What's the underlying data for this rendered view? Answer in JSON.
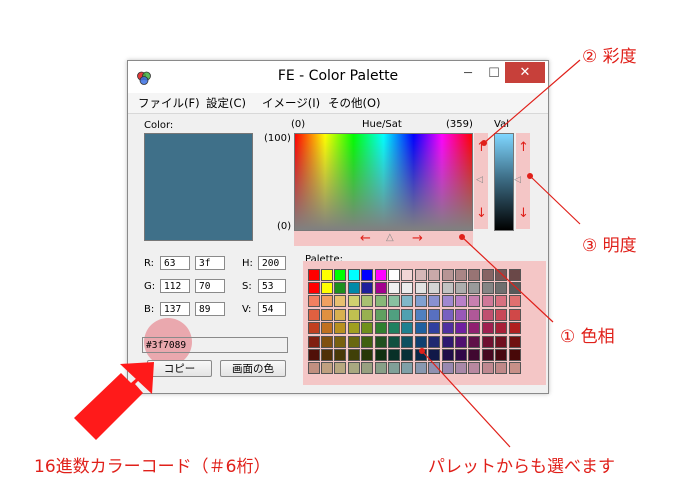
{
  "window": {
    "title": "FE - Color Palette",
    "min_glyph": "─",
    "max_glyph": "☐",
    "close_glyph": "✕"
  },
  "menu": [
    "ファイル(F)",
    "設定(C)",
    "イメージ(I)",
    "その他(O)"
  ],
  "color_label": "Color:",
  "huesat": {
    "label": "Hue/Sat",
    "min_hue": "(0)",
    "max_hue": "(359)",
    "sat_max": "(100)",
    "sat_min": "(0)",
    "nav_left": "←",
    "nav_mark": "△",
    "nav_right": "→",
    "side_up": "↑",
    "side_mark": "◁",
    "side_down": "↓"
  },
  "val": {
    "label": "Val",
    "up": "↑",
    "mark": "◁",
    "down": "↓"
  },
  "rgb": {
    "r_label": "R:",
    "r_dec": "63",
    "r_hex": "3f",
    "g_label": "G:",
    "g_dec": "112",
    "g_hex": "70",
    "b_label": "B:",
    "b_dec": "137",
    "b_hex": "89"
  },
  "hsv": {
    "h_label": "H:",
    "h": "200",
    "s_label": "S:",
    "s": "53",
    "v_label": "V:",
    "v": "54"
  },
  "hex_code": "#3f7089",
  "buttons": {
    "copy": "コピー",
    "screen_color": "画面の色"
  },
  "palette": {
    "label": "Palette:",
    "colors": [
      "#ff0000",
      "#ffff00",
      "#00ff00",
      "#00ffff",
      "#0000ff",
      "#ff00ff",
      "#ffffff",
      "#f2d5d5",
      "#d6b8b8",
      "#c9a9a9",
      "#b79595",
      "#a98686",
      "#987474",
      "#876464",
      "#785656",
      "#6a4848",
      "#ff0000",
      "#ffff00",
      "#1e8f1e",
      "#0089a8",
      "#1f1f9c",
      "#a3008f",
      "#f0f0f0",
      "#ececec",
      "#e2e2e2",
      "#d3d3d3",
      "#c2c2c2",
      "#adadad",
      "#9a9a9a",
      "#858585",
      "#6f6f6f",
      "#595959",
      "#f08060",
      "#f0a060",
      "#e8c070",
      "#d0d070",
      "#a8c070",
      "#88b878",
      "#88c0a0",
      "#80b8c8",
      "#80a0d0",
      "#8890d0",
      "#a088d0",
      "#b880c8",
      "#c880b0",
      "#d07898",
      "#d87080",
      "#e07070",
      "#e06040",
      "#e09040",
      "#d8b050",
      "#c0c050",
      "#98b050",
      "#60a060",
      "#50a080",
      "#50a0b0",
      "#5080c0",
      "#5870c0",
      "#7860c0",
      "#9858b8",
      "#b05898",
      "#c05070",
      "#c84858",
      "#d04848",
      "#c04020",
      "#c07020",
      "#b89020",
      "#a0a020",
      "#70901c",
      "#308030",
      "#208060",
      "#208090",
      "#2060a0",
      "#3040a0",
      "#5030a0",
      "#7020a0",
      "#902070",
      "#a02050",
      "#a82038",
      "#b02020",
      "#802010",
      "#805010",
      "#786010",
      "#686810",
      "#406010",
      "#205020",
      "#105040",
      "#105060",
      "#104070",
      "#202870",
      "#301870",
      "#501070",
      "#601048",
      "#701030",
      "#701020",
      "#701010",
      "#501008",
      "#503008",
      "#483808",
      "#404008",
      "#283808",
      "#103010",
      "#083028",
      "#083038",
      "#082848",
      "#101848",
      "#200c48",
      "#300848",
      "#400830",
      "#480820",
      "#480810",
      "#480808",
      "#c09080",
      "#c0a080",
      "#b8a880",
      "#a8a880",
      "#98a080",
      "#88a088",
      "#80a098",
      "#80a0a8",
      "#8898b0",
      "#9090b0",
      "#9888b0",
      "#a888a8",
      "#b888a0",
      "#c08890",
      "#c08888",
      "#c89088"
    ]
  },
  "annotations": {
    "saturation": "② 彩度",
    "brightness": "③ 明度",
    "hue": "① 色相",
    "hexcode": "16進数カラーコード（＃6桁）",
    "palette_note": "パレットからも選べます"
  },
  "colors": {
    "current": "#3f7089",
    "annotation_red": "#e0201a",
    "close_red": "#c7403a",
    "highlight_pink": "#f4c6c6"
  }
}
